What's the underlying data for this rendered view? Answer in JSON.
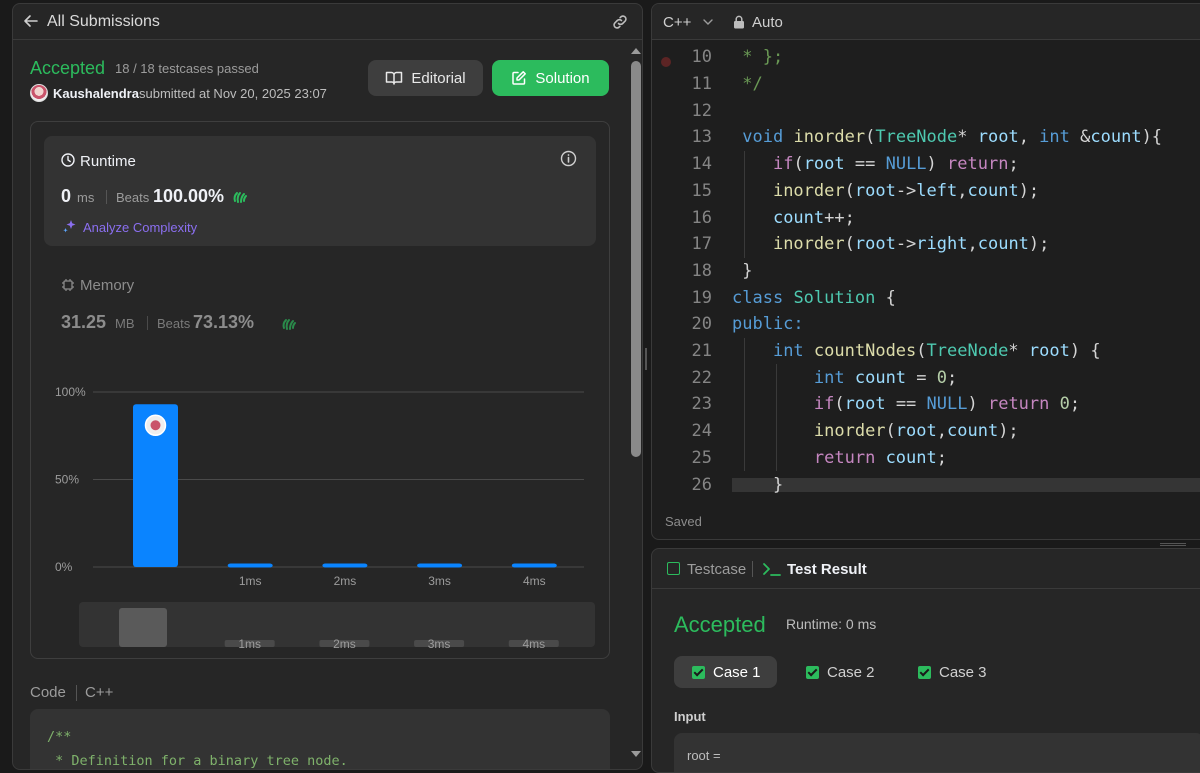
{
  "left": {
    "header_title": "All Submissions",
    "status": "Accepted",
    "testcases": "18 / 18 testcases passed",
    "submitter": "Kaushalendra",
    "submitted_at": "submitted at Nov 20, 2025 23:07",
    "editorial_label": "Editorial",
    "solution_label": "Solution",
    "runtime": {
      "label": "Runtime",
      "value": "0",
      "unit": "ms",
      "beats_label": "Beats",
      "beats_value": "100.00%",
      "analyze_label": "Analyze Complexity"
    },
    "memory": {
      "label": "Memory",
      "value": "31.25",
      "unit": "MB",
      "beats_label": "Beats",
      "beats_value": "73.13%"
    },
    "code_label": "Code",
    "code_lang": "C++",
    "code_preview": [
      "/**",
      " * Definition for a binary tree node."
    ]
  },
  "chart_data": {
    "type": "bar",
    "categories": [
      "0ms",
      "1ms",
      "2ms",
      "3ms",
      "4ms"
    ],
    "tick_labels": [
      "",
      "1ms",
      "2ms",
      "3ms",
      "4ms"
    ],
    "values": [
      93,
      2,
      2,
      2,
      2
    ],
    "highlight_index": 0,
    "ylim": [
      0,
      100
    ],
    "yticks": [
      "100%",
      "50%",
      "0%"
    ],
    "grid": true,
    "bar_color": "#0a84ff",
    "minimap_labels": [
      "",
      "1ms",
      "2ms",
      "3ms",
      "4ms"
    ]
  },
  "editor": {
    "language": "C++",
    "mode": "Auto",
    "saved_label": "Saved",
    "lines": [
      {
        "n": "10",
        "code": " * };"
      },
      {
        "n": "11",
        "code": " */"
      },
      {
        "n": "12",
        "code": ""
      },
      {
        "n": "13",
        "code": " void inorder(TreeNode* root, int &count){"
      },
      {
        "n": "14",
        "code": "    if(root == NULL) return;"
      },
      {
        "n": "15",
        "code": "    inorder(root->left,count);"
      },
      {
        "n": "16",
        "code": "    count++;"
      },
      {
        "n": "17",
        "code": "    inorder(root->right,count);"
      },
      {
        "n": "18",
        "code": " }"
      },
      {
        "n": "19",
        "code": "class Solution {"
      },
      {
        "n": "20",
        "code": "public:"
      },
      {
        "n": "21",
        "code": "    int countNodes(TreeNode* root) {"
      },
      {
        "n": "22",
        "code": "        int count = 0;"
      },
      {
        "n": "23",
        "code": "        if(root == NULL) return 0;"
      },
      {
        "n": "24",
        "code": "        inorder(root,count);"
      },
      {
        "n": "25",
        "code": "        return count;"
      },
      {
        "n": "26",
        "code": "    }"
      }
    ]
  },
  "result": {
    "tab_testcase": "Testcase",
    "tab_result": "Test Result",
    "status": "Accepted",
    "runtime": "Runtime: 0 ms",
    "cases": [
      "Case 1",
      "Case 2",
      "Case 3"
    ],
    "input_label": "Input",
    "input_value": "root ="
  },
  "colors": {
    "accent_green": "#2cbb5d",
    "bar_blue": "#0a84ff",
    "panel_bg": "#262626"
  }
}
